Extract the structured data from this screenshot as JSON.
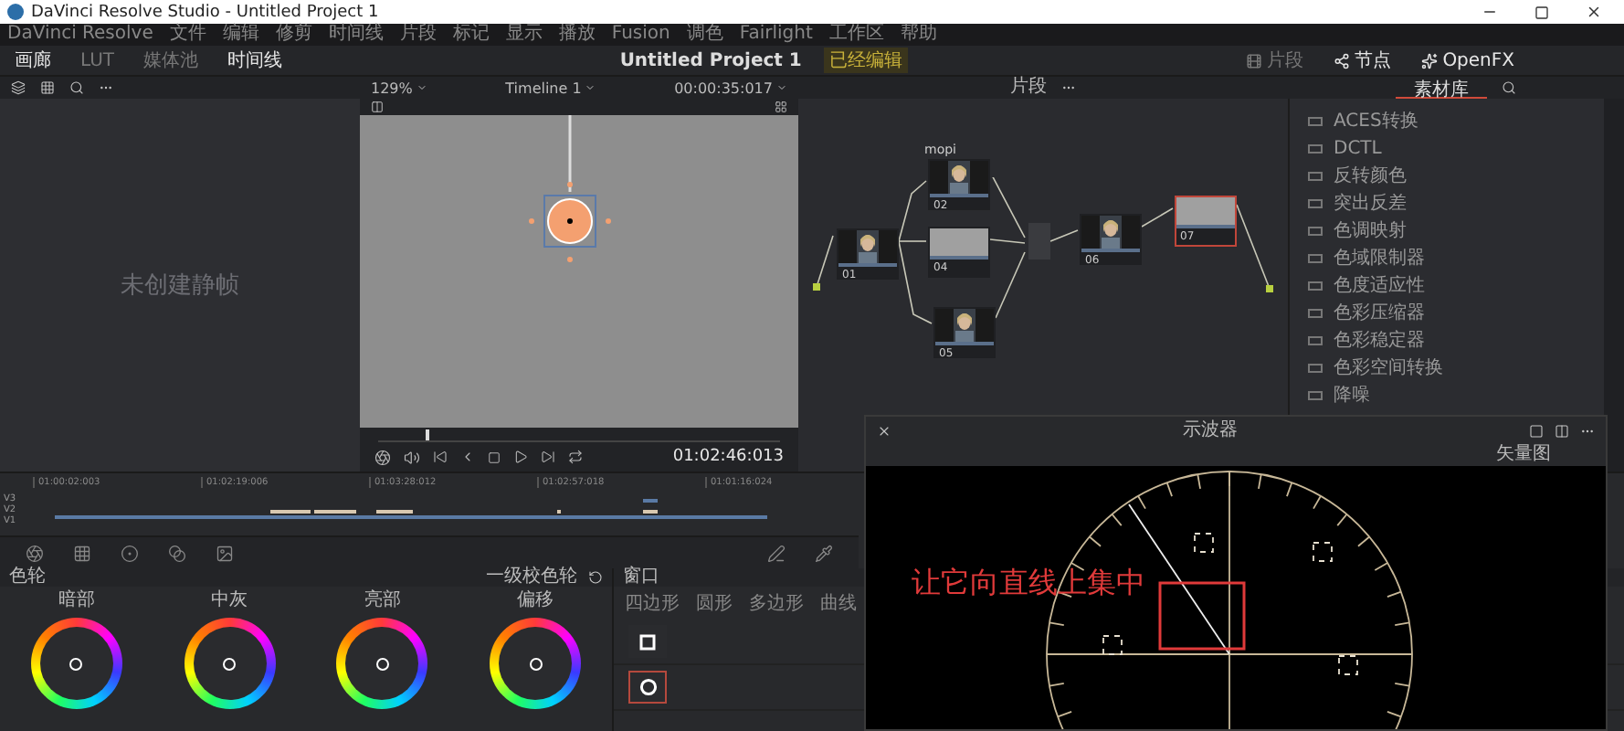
{
  "window": {
    "title": "DaVinci Resolve Studio - Untitled Project 1"
  },
  "menu": [
    "DaVinci Resolve",
    "文件",
    "编辑",
    "修剪",
    "时间线",
    "片段",
    "标记",
    "显示",
    "播放",
    "Fusion",
    "调色",
    "Fairlight",
    "工作区",
    "帮助"
  ],
  "page_tabs_left": [
    {
      "label": "画廊",
      "selected": true
    },
    {
      "label": "LUT",
      "selected": false
    },
    {
      "label": "媒体池",
      "selected": false
    },
    {
      "label": "时间线",
      "selected": true
    }
  ],
  "project": {
    "name": "Untitled Project 1",
    "status": "已经编辑"
  },
  "page_tabs_right": [
    {
      "label": "片段",
      "selected": false
    },
    {
      "label": "节点",
      "selected": true
    },
    {
      "label": "OpenFX",
      "selected": true
    }
  ],
  "viewer": {
    "zoom": "129%",
    "timeline": "Timeline 1",
    "timecode": "00:00:35:017",
    "playhead_timecode": "01:02:46:013",
    "scrubber": {
      "level": 0.12
    }
  },
  "gallery": {
    "empty_message": "未创建静帧"
  },
  "node_panel": {
    "mode": "片段"
  },
  "nodes": [
    {
      "number": "01",
      "kind": "face",
      "selected": false
    },
    {
      "number": "02",
      "kind": "face",
      "selected": false,
      "label": "mopi"
    },
    {
      "number": "04",
      "kind": "gray",
      "selected": false
    },
    {
      "number": "05",
      "kind": "face",
      "selected": false
    },
    {
      "number": "06",
      "kind": "face",
      "selected": false
    },
    {
      "number": "07",
      "kind": "gray",
      "selected": true
    }
  ],
  "library": {
    "tab": "素材库",
    "items": [
      "ACES转换",
      "DCTL",
      "反转颜色",
      "突出反差",
      "色调映射",
      "色域限制器",
      "色度适应性",
      "色彩压缩器",
      "色彩稳定器",
      "色彩空间转换",
      "降噪"
    ]
  },
  "timeline": {
    "timecodes": [
      "01:00:02:003",
      "01:02:19:006",
      "01:03:28:012",
      "01:02:57:018",
      "01:01:16:024"
    ],
    "tracks": [
      "V3",
      "V2",
      "V1"
    ]
  },
  "color_wheels": {
    "title": "色轮",
    "mode": "一级校色轮",
    "wheels": [
      "暗部",
      "中灰",
      "亮部",
      "偏移"
    ]
  },
  "window_panel": {
    "title": "窗口",
    "tools": [
      "四边形",
      "圆形",
      "多边形",
      "曲线"
    ],
    "shapes": [
      {
        "kind": "square",
        "selected": false
      },
      {
        "kind": "circle",
        "selected": true
      }
    ]
  },
  "scope": {
    "title": "示波器",
    "mode": "矢量图",
    "annotation": "让它向直线上集中"
  }
}
